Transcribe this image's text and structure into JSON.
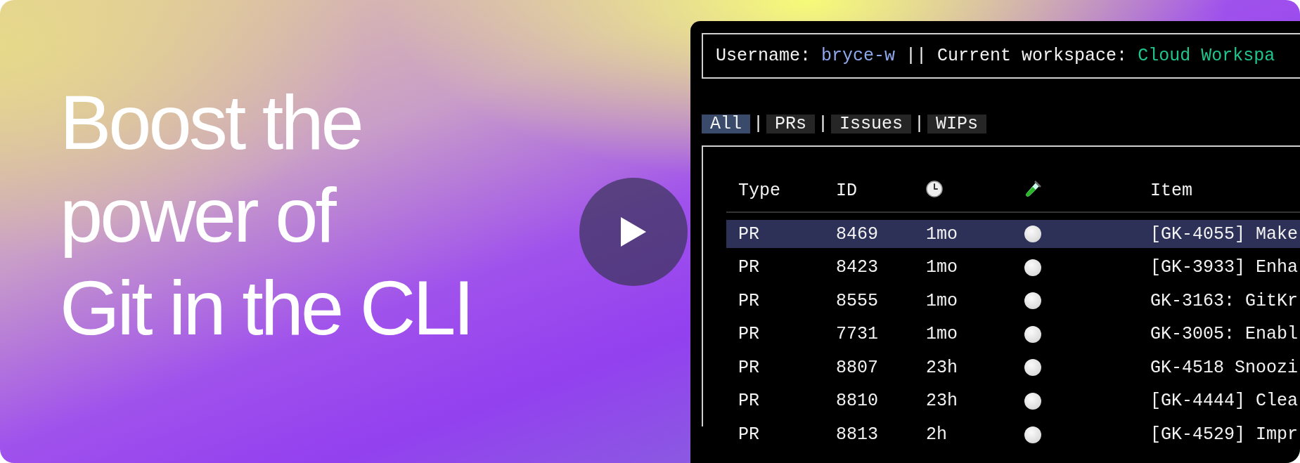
{
  "hero": {
    "headline_lines": [
      "Boost the",
      "power of",
      "Git in the CLI"
    ]
  },
  "terminal": {
    "header": {
      "username_label": "Username:",
      "username": "bryce-w",
      "divider": "||",
      "workspace_label": "Current workspace:",
      "workspace": "Cloud Workspa"
    },
    "tabs": [
      {
        "label": "All",
        "selected": true
      },
      {
        "label": "PRs",
        "selected": false
      },
      {
        "label": "Issues",
        "selected": false
      },
      {
        "label": "WIPs",
        "selected": false
      }
    ],
    "tab_separators": [
      "|",
      "|",
      "|"
    ],
    "table": {
      "columns": [
        {
          "kind": "text",
          "label": "Type"
        },
        {
          "kind": "text",
          "label": "ID"
        },
        {
          "kind": "clock"
        },
        {
          "kind": "test_tube"
        },
        {
          "kind": "text",
          "label": "Item"
        }
      ],
      "rows": [
        {
          "type": "PR",
          "id": "8469",
          "age": "1mo",
          "item": "[GK-4055] Make",
          "selected": true
        },
        {
          "type": "PR",
          "id": "8423",
          "age": "1mo",
          "item": "[GK-3933] Enha",
          "selected": false
        },
        {
          "type": "PR",
          "id": "8555",
          "age": "1mo",
          "item": "GK-3163: GitKr",
          "selected": false
        },
        {
          "type": "PR",
          "id": "7731",
          "age": "1mo",
          "item": "GK-3005: Enabl",
          "selected": false
        },
        {
          "type": "PR",
          "id": "8807",
          "age": "23h",
          "item": "GK-4518 Snoozi",
          "selected": false
        },
        {
          "type": "PR",
          "id": "8810",
          "age": "23h",
          "item": "[GK-4444] Clea",
          "selected": false
        },
        {
          "type": "PR",
          "id": "8813",
          "age": "2h",
          "item": "[GK-4529] Impr",
          "selected": false
        }
      ]
    }
  }
}
